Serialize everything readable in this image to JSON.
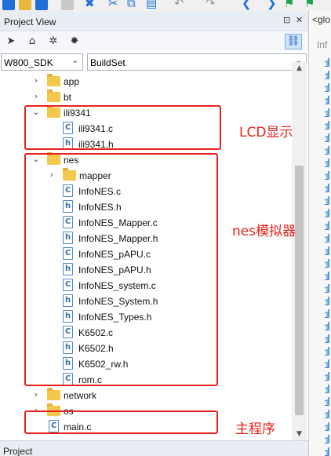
{
  "panel": {
    "title": "Project View",
    "pin_glyph": "⊡",
    "close_glyph": "✕",
    "toolbar_icons": [
      "navigate-icon",
      "home-icon",
      "sparkle-icon",
      "bug-icon",
      "link-icon"
    ],
    "target_select": "W800_SDK",
    "config_select": "BuildSet",
    "bottom_tab": "Project"
  },
  "tree": [
    {
      "label": "app",
      "kind": "folder",
      "expanded": false,
      "depth": 0
    },
    {
      "label": "bt",
      "kind": "folder",
      "expanded": false,
      "depth": 0
    },
    {
      "label": "ili9341",
      "kind": "folder",
      "expanded": true,
      "depth": 0
    },
    {
      "label": "ili9341.c",
      "kind": "c",
      "depth": 1
    },
    {
      "label": "ili9341.h",
      "kind": "h",
      "depth": 1
    },
    {
      "label": "nes",
      "kind": "folder",
      "expanded": true,
      "depth": 0
    },
    {
      "label": "mapper",
      "kind": "folder",
      "expanded": false,
      "depth": 1
    },
    {
      "label": "InfoNES.c",
      "kind": "c",
      "depth": 1
    },
    {
      "label": "InfoNES.h",
      "kind": "h",
      "depth": 1
    },
    {
      "label": "InfoNES_Mapper.c",
      "kind": "c",
      "depth": 1
    },
    {
      "label": "InfoNES_Mapper.h",
      "kind": "h",
      "depth": 1
    },
    {
      "label": "InfoNES_pAPU.c",
      "kind": "c",
      "depth": 1
    },
    {
      "label": "InfoNES_pAPU.h",
      "kind": "h",
      "depth": 1
    },
    {
      "label": "InfoNES_system.c",
      "kind": "c",
      "depth": 1
    },
    {
      "label": "InfoNES_System.h",
      "kind": "h",
      "depth": 1
    },
    {
      "label": "InfoNES_Types.h",
      "kind": "h",
      "depth": 1
    },
    {
      "label": "K6502.c",
      "kind": "c",
      "depth": 1
    },
    {
      "label": "K6502.h",
      "kind": "h",
      "depth": 1
    },
    {
      "label": "K6502_rw.h",
      "kind": "h",
      "depth": 1
    },
    {
      "label": "rom.c",
      "kind": "c",
      "depth": 1
    },
    {
      "label": "network",
      "kind": "folder",
      "expanded": false,
      "depth": 0
    },
    {
      "label": "os",
      "kind": "folder",
      "expanded": false,
      "depth": 0
    },
    {
      "label": "main.c",
      "kind": "c",
      "depth": 0,
      "top_level_file": true
    }
  ],
  "editor": {
    "tab_label": "<glo",
    "sub_label": "Inf",
    "line_digit": "1"
  },
  "annotations": {
    "lcd": "LCD显示",
    "nes": "nes模拟器",
    "main": "主程序",
    "color": "#e8231c"
  }
}
